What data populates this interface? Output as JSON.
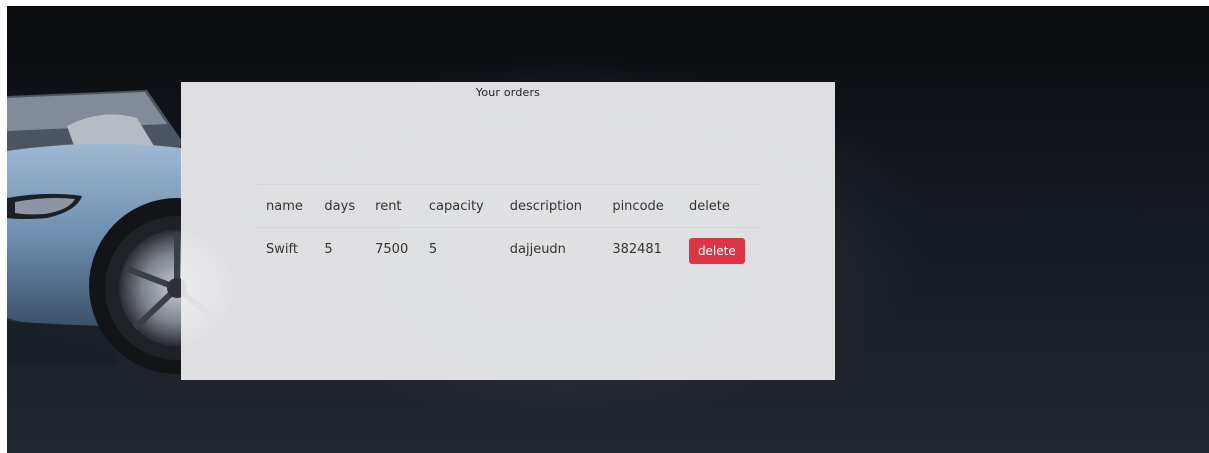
{
  "panel": {
    "title": "Your orders"
  },
  "table": {
    "headers": [
      "name",
      "days",
      "rent",
      "capacity",
      "description",
      "pincode",
      "delete"
    ],
    "rows": [
      {
        "name": "Swift",
        "days": "5",
        "rent": "7500",
        "capacity": "5",
        "description": "dajjeudn",
        "pincode": "382481",
        "delete_label": "delete"
      }
    ]
  },
  "colors": {
    "delete_button": "#dc3545",
    "panel_bg": "#eeeef0",
    "page_bg": "#141820"
  }
}
